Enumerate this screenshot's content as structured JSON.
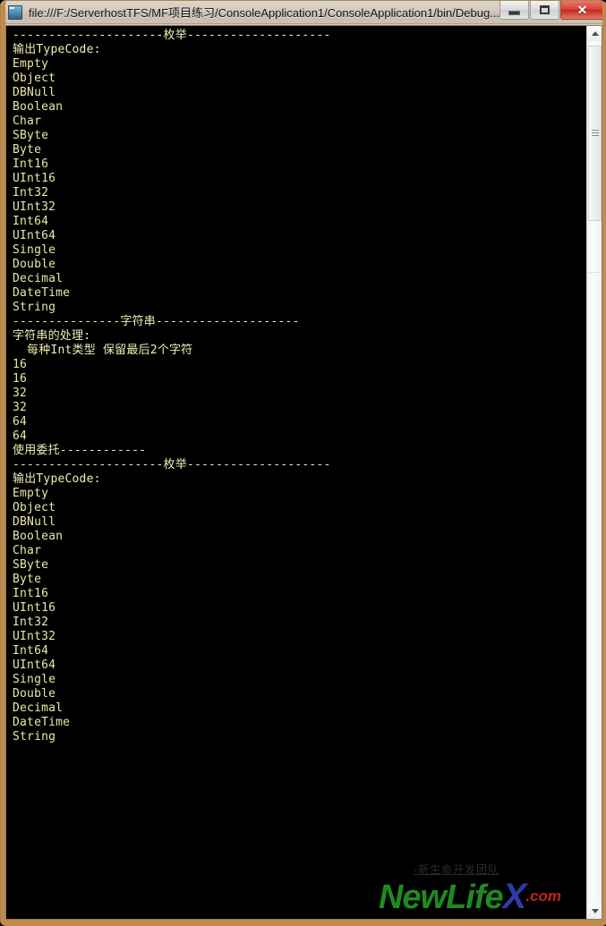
{
  "window": {
    "title": "file:///F:/ServerhostTFS/MF项目练习/ConsoleApplication1/ConsoleApplication1/bin/Debug...",
    "icon": "console-app-icon",
    "buttons": {
      "minimize_label": "—",
      "maximize_label": "",
      "close_label": "✕"
    },
    "frame_color": "#c08a4a",
    "titlebar_color": "#d3c9be"
  },
  "console": {
    "background": "#000000",
    "foreground": "#e9e8a4",
    "lines": [
      "---------------------枚举--------------------",
      "输出TypeCode:",
      "Empty",
      "Object",
      "DBNull",
      "Boolean",
      "Char",
      "SByte",
      "Byte",
      "Int16",
      "UInt16",
      "Int32",
      "UInt32",
      "Int64",
      "UInt64",
      "Single",
      "Double",
      "Decimal",
      "DateTime",
      "String",
      "---------------字符串--------------------",
      "字符串的处理:",
      "  每种Int类型 保留最后2个字符",
      "16",
      "16",
      "32",
      "32",
      "64",
      "64",
      "使用委托------------",
      "---------------------枚举--------------------",
      "输出TypeCode:",
      "Empty",
      "Object",
      "DBNull",
      "Boolean",
      "Char",
      "SByte",
      "Byte",
      "Int16",
      "UInt16",
      "Int32",
      "UInt32",
      "Int64",
      "UInt64",
      "Single",
      "Double",
      "Decimal",
      "DateTime",
      "String"
    ]
  },
  "watermark": {
    "subtitle": "-新生命开发团队",
    "logo_main": "NewLife",
    "logo_x": "X",
    "logo_tld": ".com",
    "color_main": "#1f8a1f",
    "color_x": "#2b3ea8",
    "color_tld": "#c0241c"
  },
  "scrollbar": {
    "up_arrow": "scroll-up-arrow",
    "down_arrow": "scroll-down-arrow",
    "thumb": "scroll-thumb"
  }
}
